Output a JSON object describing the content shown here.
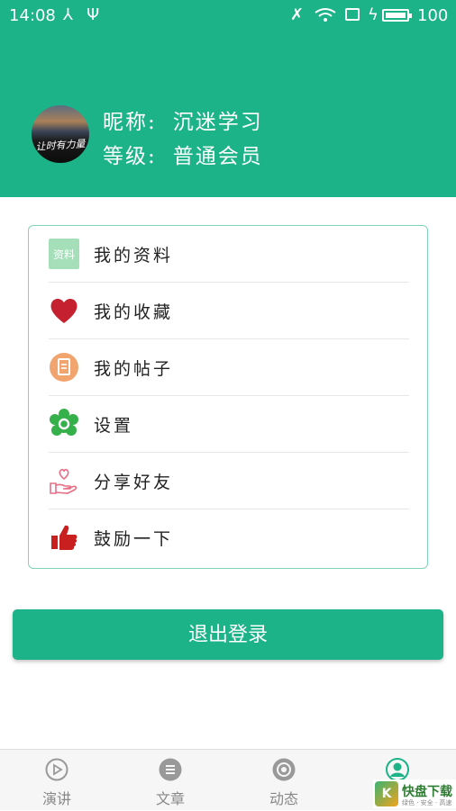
{
  "status": {
    "time": "14:08",
    "battery": "100"
  },
  "profile": {
    "nickname_label": "昵称:",
    "nickname": "沉迷学习",
    "level_label": "等级:",
    "level": "普通会员",
    "avatar_text": "让时有力量"
  },
  "menu": {
    "items": [
      {
        "label": "我的资料",
        "icon": "profile-icon",
        "icon_text": "资料"
      },
      {
        "label": "我的收藏",
        "icon": "heart-icon"
      },
      {
        "label": "我的帖子",
        "icon": "document-icon"
      },
      {
        "label": "设置",
        "icon": "settings-flower-icon"
      },
      {
        "label": "分享好友",
        "icon": "share-hand-heart-icon"
      },
      {
        "label": "鼓励一下",
        "icon": "thumbs-up-icon"
      }
    ]
  },
  "logout_label": "退出登录",
  "tabs": [
    {
      "label": "演讲",
      "icon": "play-circle-icon"
    },
    {
      "label": "文章",
      "icon": "article-icon"
    },
    {
      "label": "动态",
      "icon": "aperture-icon"
    },
    {
      "label": "",
      "icon": "user-icon",
      "active": true
    }
  ],
  "watermark": {
    "title": "快盘下载",
    "subtitle": "绿色 · 安全 · 高速",
    "badge": "K"
  },
  "colors": {
    "primary": "#1bb387",
    "card_border": "#7fd4ba",
    "heart": "#c4202f",
    "doc": "#f2a46f",
    "flower": "#35b04a",
    "thumb": "#c9201f"
  }
}
